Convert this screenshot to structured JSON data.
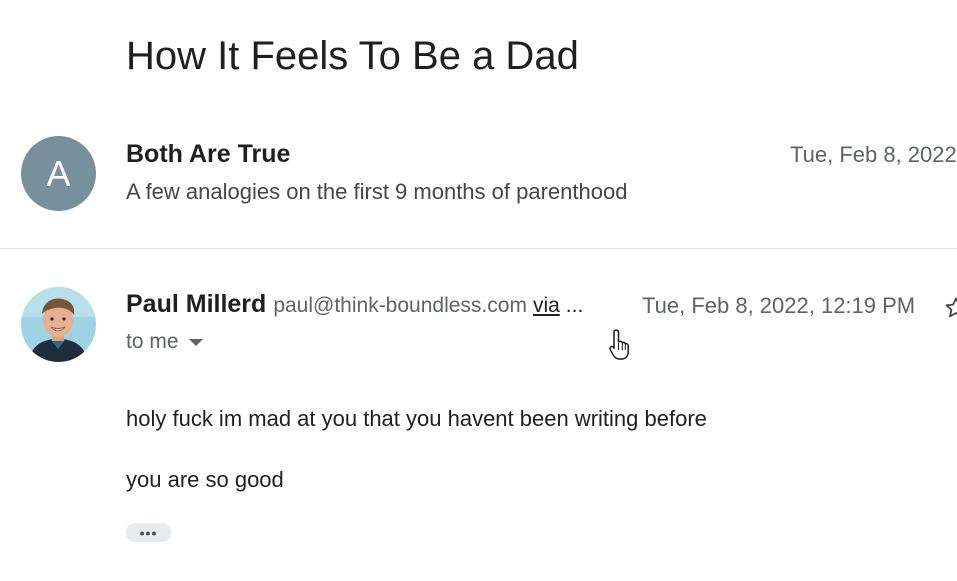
{
  "thread": {
    "subject": "How It Feels To Be a Dad"
  },
  "messages": [
    {
      "avatar_letter": "A",
      "avatar_color": "#78909c",
      "sender": "Both Are True",
      "date": "Tue, Feb 8, 2022",
      "snippet": "A few analogies on the first 9 months of parenthood"
    },
    {
      "sender": "Paul Millerd",
      "email": "paul@think-boundless.com",
      "via_label": "via",
      "ellipsis": "...",
      "date": "Tue, Feb 8, 2022, 12:19 PM",
      "recipient_label": "to me",
      "body": [
        "holy fuck im mad at you that you havent been writing before",
        "you are so good"
      ],
      "more_label": "•••"
    }
  ],
  "icons": {
    "star": "star-icon",
    "caret": "chevron-down-icon",
    "cursor": "hand-pointer-icon",
    "avatar_photo": "avatar-photo"
  }
}
